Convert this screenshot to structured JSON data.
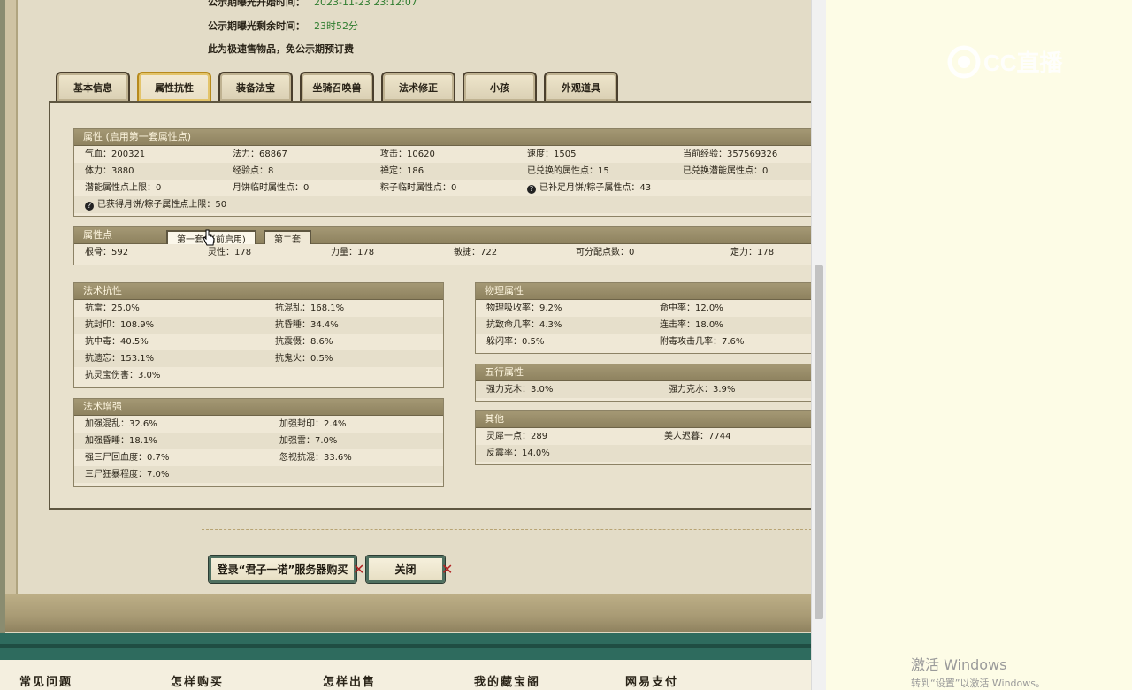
{
  "top": {
    "line1_label": "公示期曝光开始时间：",
    "line1_value": "2023-11-23 23:12:07",
    "line2_label": "公示期曝光剩余时间：",
    "line2_value": "23时52分",
    "line3": "此为极速售物品，免公示期预订费"
  },
  "tabs": [
    {
      "label": "基本信息",
      "active": false
    },
    {
      "label": "属性抗性",
      "active": true
    },
    {
      "label": "装备法宝",
      "active": false
    },
    {
      "label": "坐骑召唤兽",
      "active": false
    },
    {
      "label": "法术修正",
      "active": false
    },
    {
      "label": "小孩",
      "active": false
    },
    {
      "label": "外观道具",
      "active": false
    }
  ],
  "attributes": {
    "title": "属性 (启用第一套属性点)",
    "rows": [
      [
        "气血：200321",
        "法力：68867",
        "攻击：10620",
        "速度：1505",
        "当前经验：357569326"
      ],
      [
        "体力：3880",
        "经验点：8",
        "禅定：186",
        "已兑换的属性点：15",
        "已兑换潜能属性点：0"
      ],
      [
        "潜能属性点上限：0",
        "月饼临时属性点：0",
        "粽子临时属性点：0",
        "已补足月饼/粽子属性点：43",
        ""
      ],
      [
        "已获得月饼/粽子属性点上限：50",
        "",
        "",
        "",
        ""
      ]
    ]
  },
  "points": {
    "title": "属性点",
    "subtabs": [
      "第一套(当前启用)",
      "第二套"
    ],
    "values": [
      "根骨：592",
      "灵性：178",
      "力量：178",
      "敏捷：722",
      "可分配点数：0",
      "定力：178"
    ]
  },
  "magic_resist": {
    "title": "法术抗性",
    "rows": [
      [
        "抗雷：25.0%",
        "抗混乱：168.1%"
      ],
      [
        "抗封印：108.9%",
        "抗昏睡：34.4%"
      ],
      [
        "抗中毒：40.5%",
        "抗震慑：8.6%"
      ],
      [
        "抗遗忘：153.1%",
        "抗鬼火：0.5%"
      ],
      [
        "抗灵宝伤害：3.0%",
        ""
      ]
    ]
  },
  "magic_boost": {
    "title": "法术增强",
    "rows": [
      [
        "加强混乱：32.6%",
        "加强封印：2.4%"
      ],
      [
        "加强昏睡：18.1%",
        "加强雷：7.0%"
      ],
      [
        "强三尸回血度：0.7%",
        "忽视抗混：33.6%"
      ],
      [
        "三尸狂暴程度：7.0%",
        ""
      ]
    ]
  },
  "physical": {
    "title": "物理属性",
    "rows": [
      [
        "物理吸收率：9.2%",
        "命中率：12.0%"
      ],
      [
        "抗致命几率：4.3%",
        "连击率：18.0%"
      ],
      [
        "躲闪率：0.5%",
        "附毒攻击几率：7.6%"
      ]
    ]
  },
  "five_elements": {
    "title": "五行属性",
    "rows": [
      [
        "强力克木：3.0%",
        "强力克水：3.9%"
      ]
    ]
  },
  "other": {
    "title": "其他",
    "rows": [
      [
        "灵犀一点：289",
        "美人迟暮：7744"
      ],
      [
        "反震率：14.0%",
        ""
      ]
    ]
  },
  "buttons": {
    "buy": "登录“君子一诺”服务器购买",
    "close": "关闭"
  },
  "footer": [
    "常见问题",
    "怎样购买",
    "怎样出售",
    "我的藏宝阁",
    "网易支付"
  ],
  "watermark": {
    "logo_text": "CC直播",
    "activate_title": "激活 Windows",
    "activate_sub": "转到“设置”以激活 Windows。"
  }
}
